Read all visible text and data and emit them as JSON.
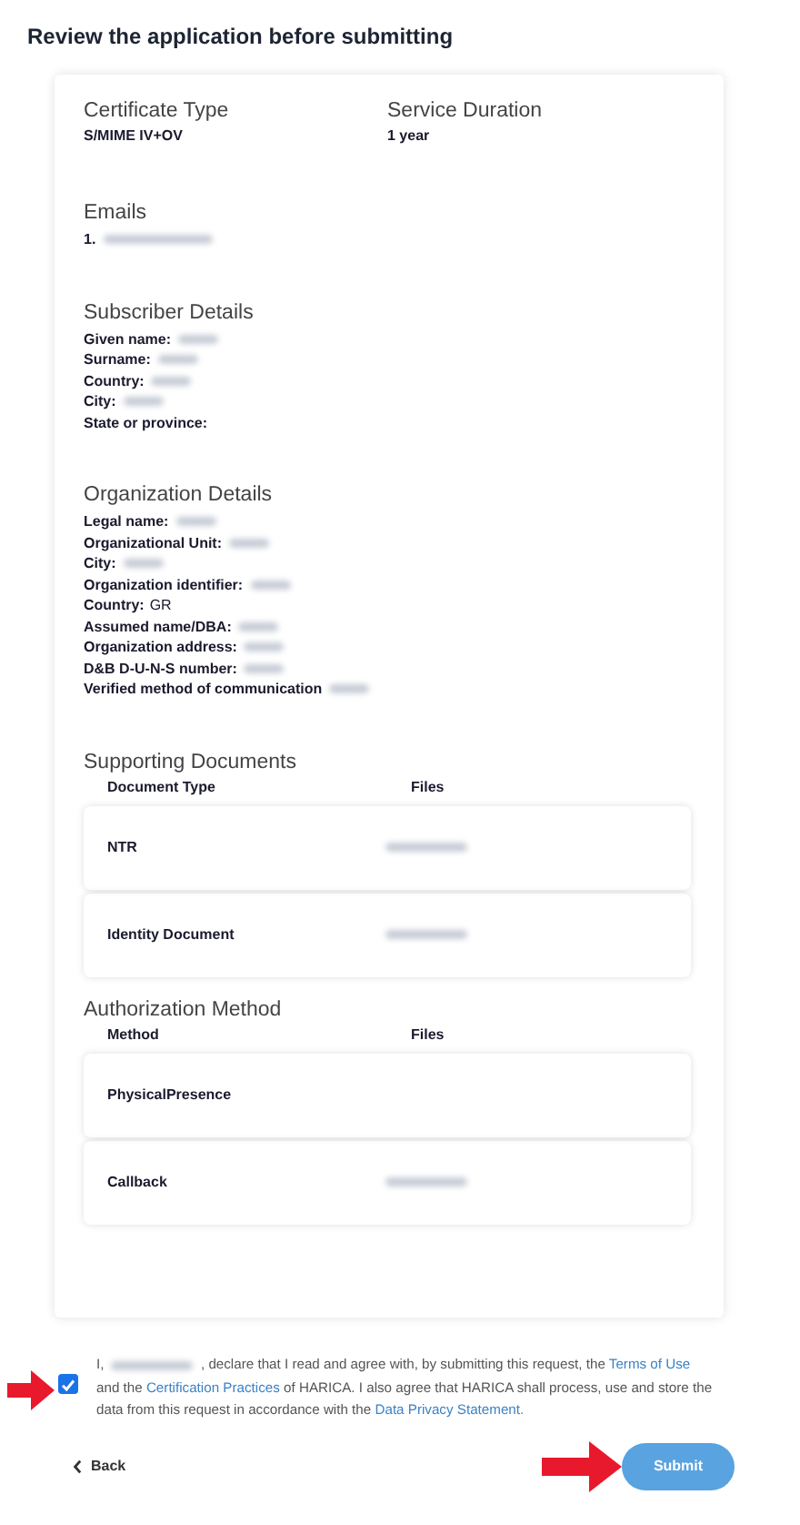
{
  "title": "Review the application before submitting",
  "summary": [
    {
      "label": "Certificate Type",
      "value": "S/MIME IV+OV"
    },
    {
      "label": "Service Duration",
      "value": "1 year"
    }
  ],
  "emails": {
    "heading": "Emails",
    "items": [
      {
        "index": "1.",
        "redacted": true
      }
    ]
  },
  "subscriber": {
    "heading": "Subscriber Details",
    "fields": [
      {
        "label": "Given name:",
        "redacted": true
      },
      {
        "label": "Surname:",
        "redacted": true
      },
      {
        "label": "Country:",
        "redacted": true
      },
      {
        "label": "City:",
        "redacted": true
      },
      {
        "label": "State or province:",
        "redacted": false
      }
    ]
  },
  "organization": {
    "heading": "Organization Details",
    "fields": [
      {
        "label": "Legal name:",
        "redacted": true
      },
      {
        "label": "Organizational Unit:",
        "redacted": true
      },
      {
        "label": "City:",
        "redacted": true
      },
      {
        "label": "Organization identifier:",
        "redacted": true
      },
      {
        "label": "Country:",
        "value": "GR",
        "redacted": false
      },
      {
        "label": "Assumed name/DBA:",
        "redacted": true
      },
      {
        "label": "Organization address:",
        "redacted": true
      },
      {
        "label": "D&B D-U-N-S number:",
        "redacted": true
      },
      {
        "label": "Verified method of communication",
        "redacted": true
      }
    ]
  },
  "tables": [
    {
      "heading": "Supporting Documents",
      "columns": [
        "Document Type",
        "Files"
      ],
      "rows": [
        {
          "name": "NTR",
          "file_redacted": true
        },
        {
          "name": "Identity Document",
          "file_redacted": true
        }
      ]
    },
    {
      "heading": "Authorization Method",
      "columns": [
        "Method",
        "Files"
      ],
      "rows": [
        {
          "name": "PhysicalPresence",
          "file_redacted": false
        },
        {
          "name": "Callback",
          "file_redacted": true
        }
      ]
    }
  ],
  "declaration": {
    "checked": true,
    "parts": [
      {
        "kind": "text",
        "text": "I,"
      },
      {
        "kind": "redacted"
      },
      {
        "kind": "text",
        "text": ", declare that I read and agree with, by submitting this request, the"
      },
      {
        "kind": "link",
        "text": "Terms of Use"
      },
      {
        "kind": "text",
        "text": "and the"
      },
      {
        "kind": "link",
        "text": "Certification Practices"
      },
      {
        "kind": "text",
        "text": "of HARICA. I also agree that HARICA shall process, use and store the data from this request in accordance with the"
      },
      {
        "kind": "link",
        "text": "Data Privacy Statement."
      }
    ]
  },
  "back": "Back",
  "submit": "Submit"
}
